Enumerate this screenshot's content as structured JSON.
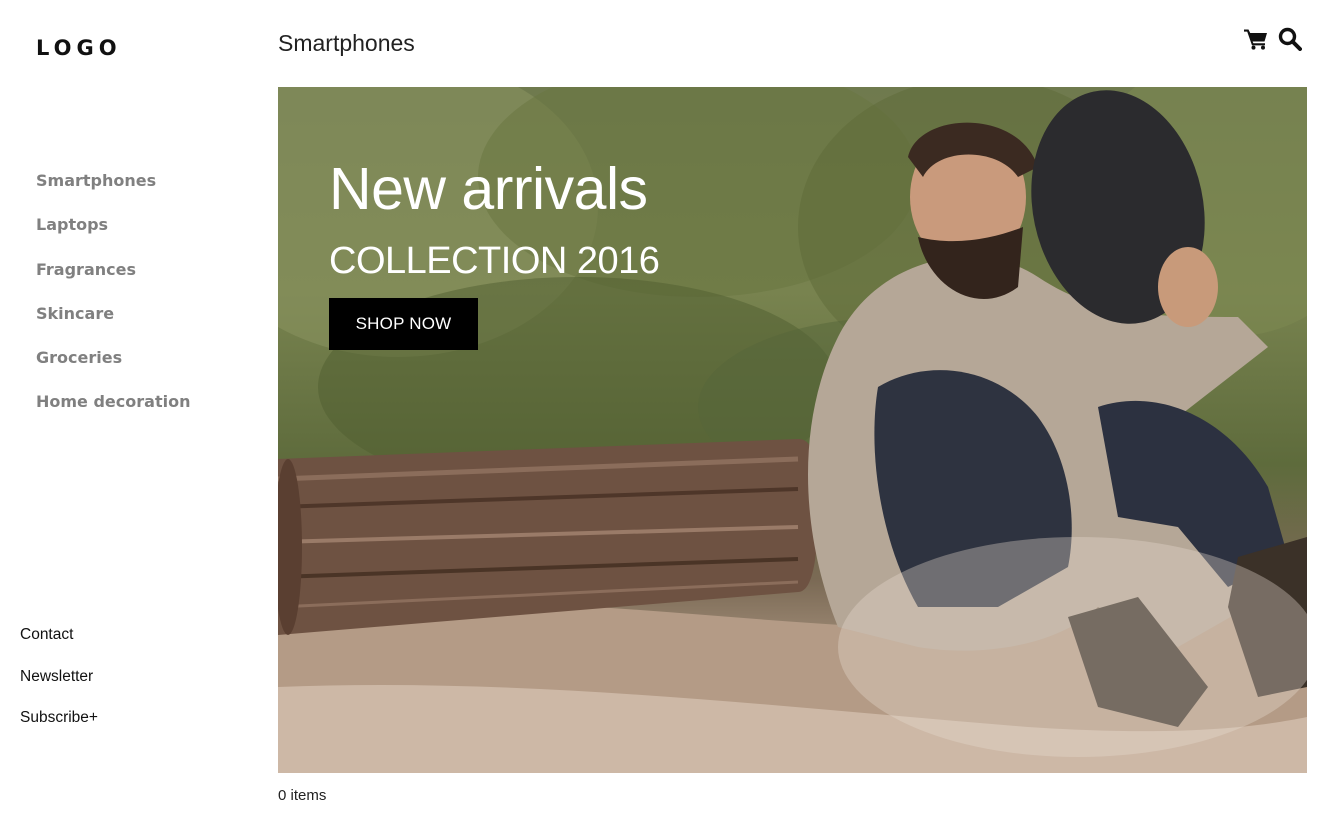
{
  "brand": {
    "logo_text": "LOGO"
  },
  "sidebar": {
    "items": [
      {
        "label": "Smartphones"
      },
      {
        "label": "Laptops"
      },
      {
        "label": "Fragrances"
      },
      {
        "label": "Skincare"
      },
      {
        "label": "Groceries"
      },
      {
        "label": "Home decoration"
      }
    ]
  },
  "footer_links": {
    "items": [
      {
        "label": "Contact"
      },
      {
        "label": "Newsletter"
      },
      {
        "label": "Subscribe+"
      }
    ]
  },
  "header": {
    "title": "Smartphones",
    "icons": [
      "cart-icon",
      "search-icon"
    ]
  },
  "hero": {
    "headline": "New arrivals",
    "subheadline": "COLLECTION 2016",
    "cta_label": "SHOP NOW"
  },
  "catalog": {
    "item_count_text": "0 items"
  },
  "colors": {
    "nav_text": "#808080",
    "text": "#222222",
    "cta_bg": "#000000",
    "cta_text": "#ffffff"
  }
}
